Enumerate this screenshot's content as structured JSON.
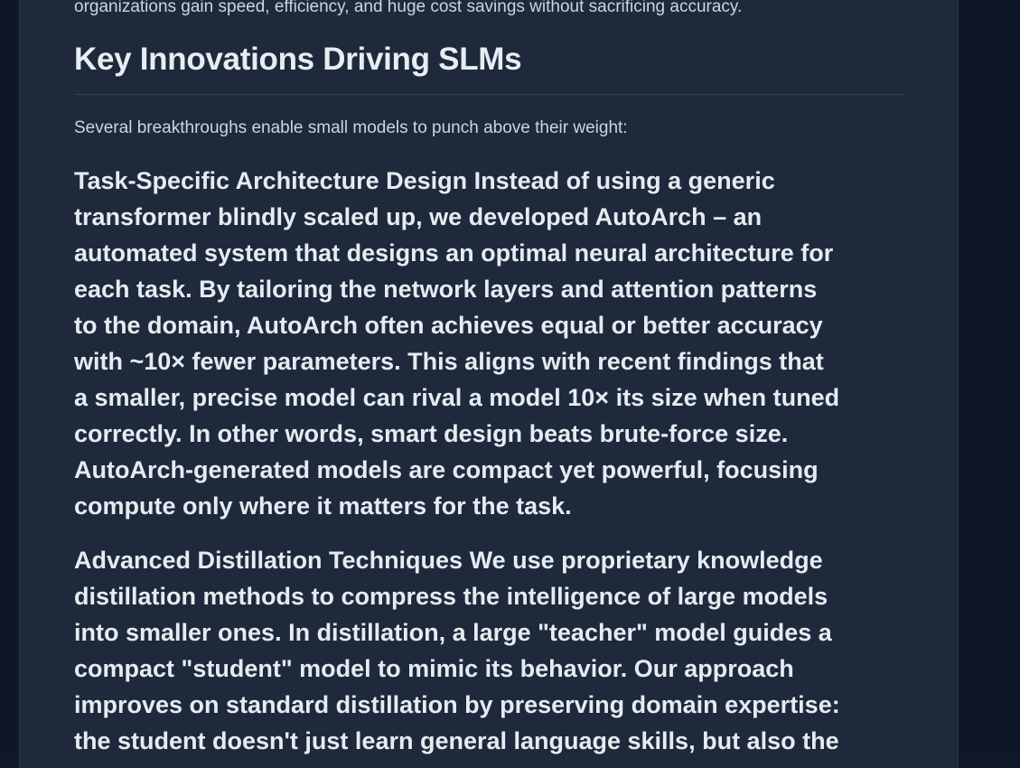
{
  "article": {
    "lead_tail": "organizations gain speed, efficiency, and huge cost savings without sacrificing accuracy.",
    "section_title": "Key Innovations Driving SLMs",
    "intro": "Several breakthroughs enable small models to punch above their weight:",
    "features": [
      {
        "lines": [
          "Task-Specific Architecture Design Instead of using a generic",
          "transformer blindly scaled up, we developed AutoArch – an",
          "automated system that designs an optimal neural architecture for",
          "each task. By tailoring the network layers and attention patterns",
          "to the domain, AutoArch often achieves equal or better accuracy",
          "with ~10× fewer parameters. This aligns with recent findings that",
          "a smaller, precise model can rival a model 10× its size when tuned",
          "correctly. In other words, smart design beats brute-force size.",
          "AutoArch-generated models are compact yet powerful, focusing",
          "compute only where it matters for the task."
        ]
      },
      {
        "lines": [
          "Advanced Distillation Techniques We use proprietary knowledge",
          "distillation methods to compress the intelligence of large models",
          "into smaller ones. In distillation, a large \"teacher\" model guides a",
          "compact \"student\" model to mimic its behavior. Our approach",
          "improves on standard distillation by preserving domain expertise:",
          "the student doesn't just learn general language skills, but also the"
        ]
      }
    ]
  }
}
